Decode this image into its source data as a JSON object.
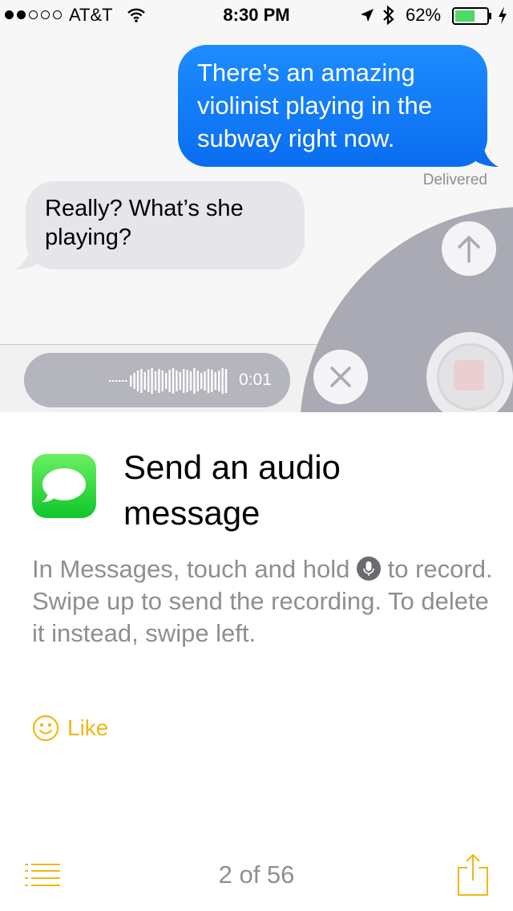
{
  "status_bar": {
    "carrier": "AT&T",
    "time": "8:30 PM",
    "battery_percent": "62%",
    "signal_filled": 2,
    "signal_total": 5,
    "battery_level": 0.62,
    "icons": [
      "wifi-icon",
      "location-arrow-icon",
      "bluetooth-icon",
      "battery-icon",
      "charging-icon"
    ]
  },
  "conversation": {
    "sent_message": "There’s an amazing violinist playing in the subway right now.",
    "delivered_label": "Delivered",
    "received_message": "Really? What’s she playing?"
  },
  "audio_recording": {
    "duration": "0:01"
  },
  "tip": {
    "title": "Send an audio message",
    "body_before_icon": "In Messages, touch and hold ",
    "body_after_icon": " to record. Swipe up to send the recording. To delete it instead, swipe left.",
    "like_label": "Like"
  },
  "toolbar": {
    "page_indicator": "2 of 56"
  },
  "colors": {
    "sent_bubble": "#0a6df0",
    "received_bubble": "#e5e5ea",
    "accent": "#f0b814",
    "app_icon_green": "#2fd43a"
  }
}
